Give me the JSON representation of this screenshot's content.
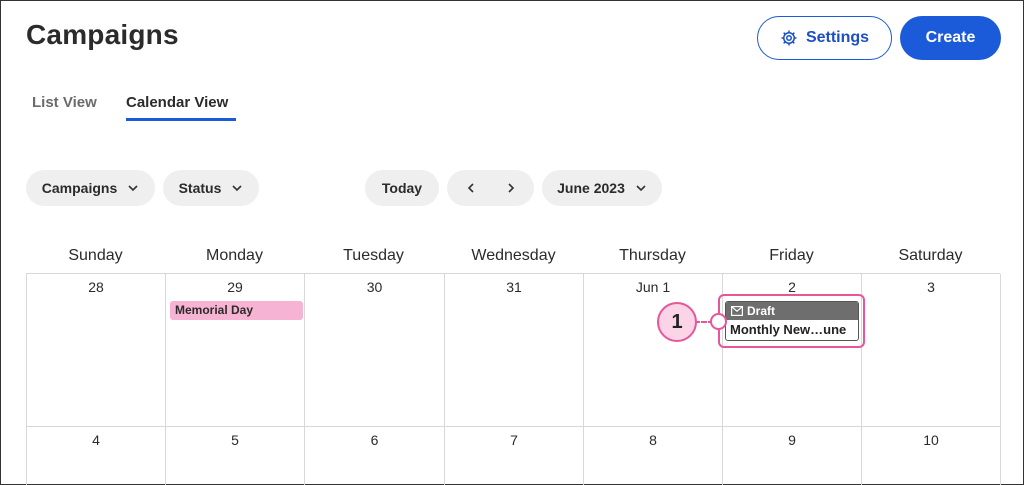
{
  "header": {
    "title": "Campaigns",
    "settings_label": "Settings",
    "create_label": "Create"
  },
  "tabs": [
    {
      "label": "List View",
      "active": false
    },
    {
      "label": "Calendar View",
      "active": true
    }
  ],
  "filters": {
    "campaigns_label": "Campaigns",
    "status_label": "Status",
    "today_label": "Today",
    "month_label": "June 2023"
  },
  "calendar": {
    "weekdays": [
      "Sunday",
      "Monday",
      "Tuesday",
      "Wednesday",
      "Thursday",
      "Friday",
      "Saturday"
    ],
    "weeks": [
      [
        "28",
        "29",
        "30",
        "31",
        "Jun 1",
        "2",
        "3"
      ],
      [
        "4",
        "5",
        "6",
        "7",
        "8",
        "9",
        "10"
      ]
    ],
    "events": {
      "holiday": "Memorial Day",
      "draft_status": "Draft",
      "draft_title": "Monthly New…une"
    }
  },
  "callout": {
    "number": "1"
  },
  "colors": {
    "accent": "#1b5ad8",
    "highlight": "#e8559b",
    "holiday": "#f7b3d3",
    "draft_bar": "#6e6e6e"
  },
  "icons": {
    "settings": "gear-icon",
    "dropdown": "chevron-down-icon",
    "prev": "chevron-left-icon",
    "next": "chevron-right-icon",
    "draft": "envelope-icon"
  }
}
